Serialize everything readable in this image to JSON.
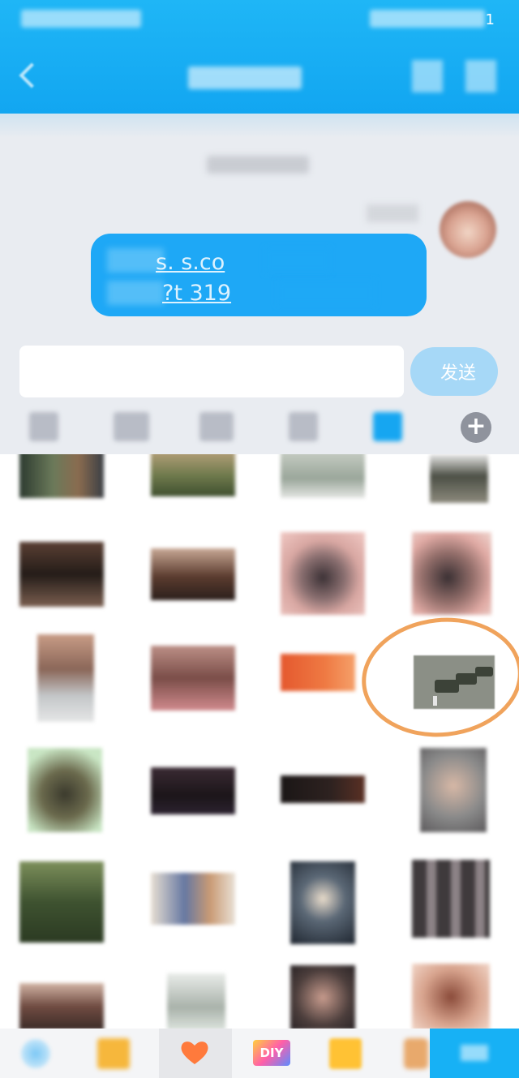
{
  "status_bar": {
    "battery_digit": "1"
  },
  "chat": {
    "message_link_line1": "s.      s.co",
    "message_link_line2": "?t       319"
  },
  "input": {
    "send_label": "发送"
  },
  "toolbar": {
    "icons": [
      "emoji-icon",
      "gif-icon",
      "image-icon",
      "sticker-icon",
      "favorites-icon",
      "plus-icon"
    ],
    "plus_symbol": "+"
  },
  "bottom_bar": {
    "tabs": [
      "sparkle-icon",
      "gift-icon",
      "heart-icon",
      "diy-icon",
      "folder-icon",
      "dog-icon"
    ],
    "diy_label": "DIY",
    "selected_tab": "heart-icon"
  },
  "colors": {
    "header": "#1fb6f6",
    "bubble": "#1ea8f6",
    "send_button_disabled": "#a6d8f7",
    "highlight_circle": "#f0a35c",
    "heart": "#ff7a3c"
  }
}
